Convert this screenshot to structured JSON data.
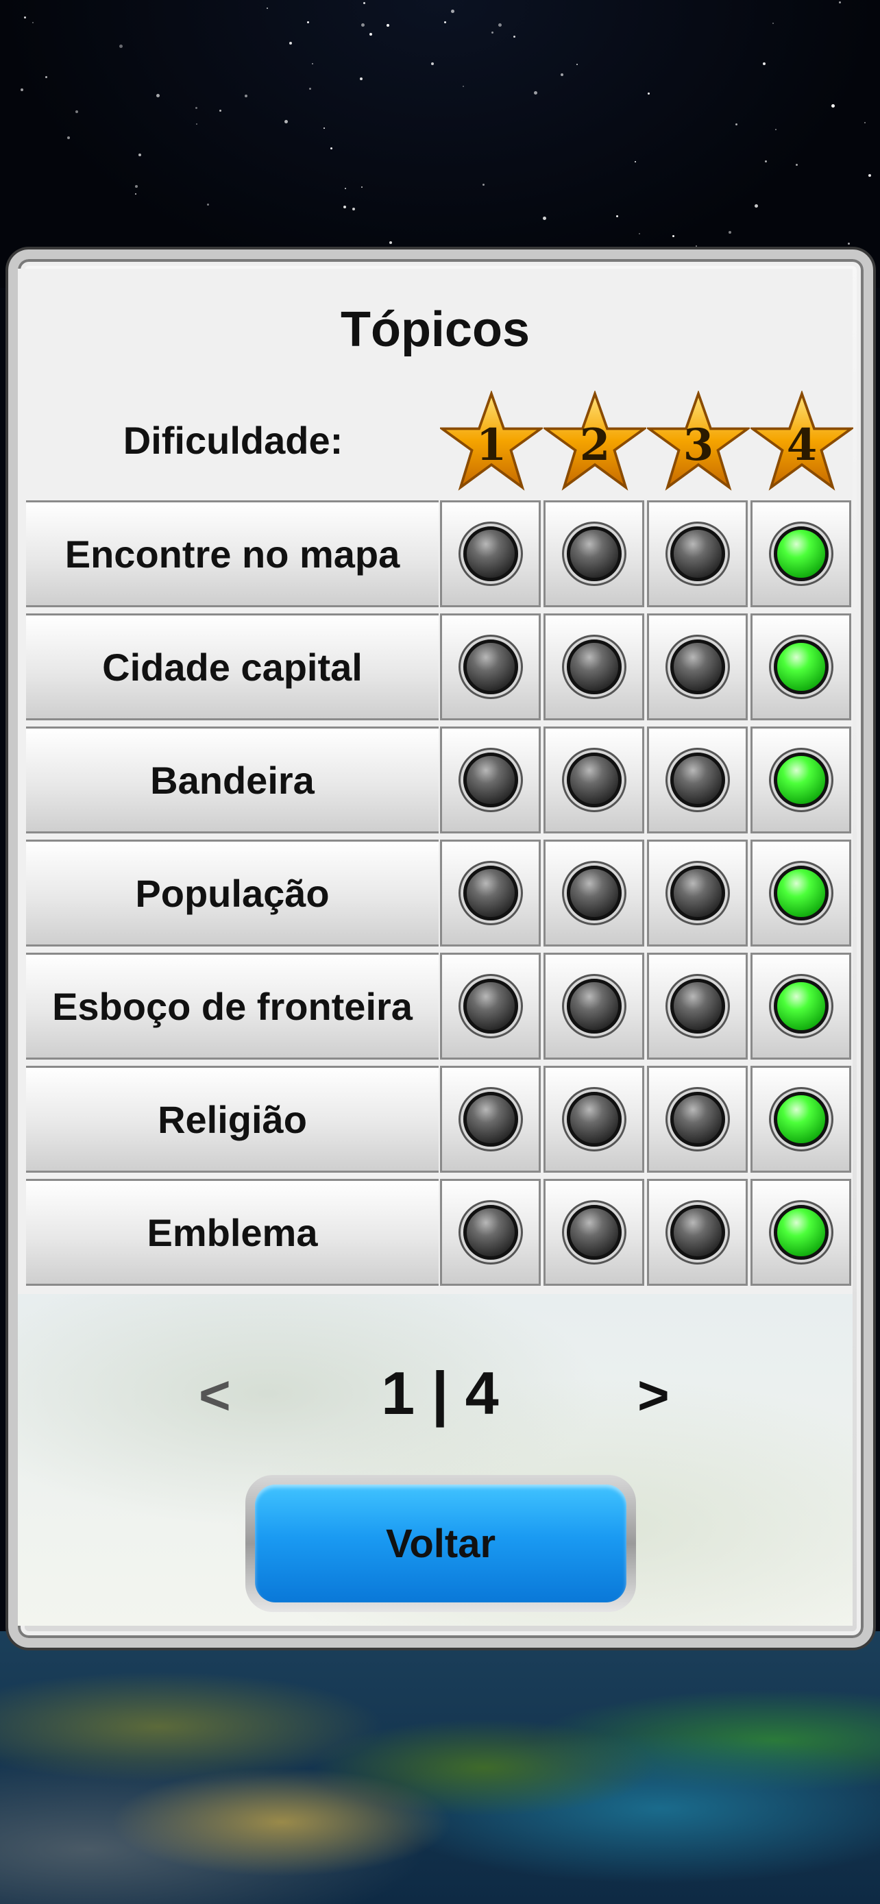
{
  "screen": {
    "title": "Tópicos",
    "difficulty_label": "Dificuldade:",
    "difficulty_levels": [
      "1",
      "2",
      "3",
      "4"
    ]
  },
  "topics": [
    {
      "label": "Encontre no mapa",
      "selected_level": 4
    },
    {
      "label": "Cidade capital",
      "selected_level": 4
    },
    {
      "label": "Bandeira",
      "selected_level": 4
    },
    {
      "label": "População",
      "selected_level": 4
    },
    {
      "label": "Esboço de fronteira",
      "selected_level": 4
    },
    {
      "label": "Religião",
      "selected_level": 4
    },
    {
      "label": "Emblema",
      "selected_level": 4
    }
  ],
  "pager": {
    "prev": "<",
    "text": "1 | 4",
    "next": ">"
  },
  "back_button": {
    "label": "Voltar"
  },
  "colors": {
    "led_on": "#4cff3a",
    "led_off": "#2a2a2a",
    "button_blue": "#1a9af2",
    "star_gold": "#f5a400"
  }
}
